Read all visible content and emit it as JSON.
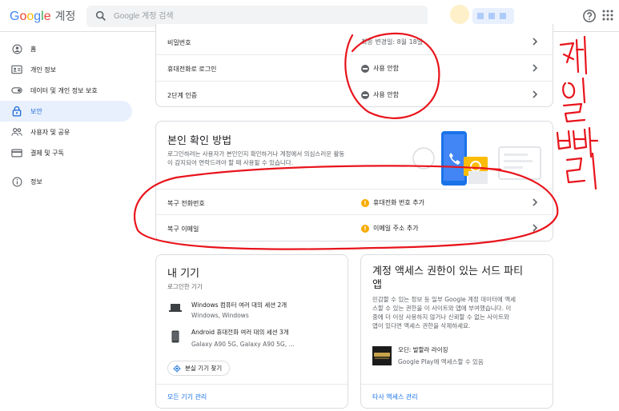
{
  "header": {
    "logo_letters": [
      "G",
      "o",
      "o",
      "g",
      "l",
      "e"
    ],
    "product": "계정",
    "search_placeholder": "Google 계정 검색"
  },
  "sidebar": {
    "items": [
      {
        "label": "홈",
        "icon": "home-icon"
      },
      {
        "label": "개인 정보",
        "icon": "id-card-icon"
      },
      {
        "label": "데이터 및 개인 정보 보호",
        "icon": "toggle-icon"
      },
      {
        "label": "보안",
        "icon": "lock-icon",
        "active": true
      },
      {
        "label": "사용자 및 공유",
        "icon": "people-icon"
      },
      {
        "label": "결제 및 구독",
        "icon": "credit-card-icon"
      },
      {
        "label": "정보",
        "icon": "info-icon"
      }
    ]
  },
  "signin": {
    "rows": [
      {
        "label": "비밀번호",
        "value": "최종 변경일: 8월 18일"
      },
      {
        "label": "휴대전화로 로그인",
        "value": "사용 안함"
      },
      {
        "label": "2단계 인증",
        "value": "사용 안함"
      }
    ]
  },
  "verify": {
    "title": "본인 확인 방법",
    "desc_line1": "로그인하려는 사용자가 본인인지 확인하거나 계정에서 의심스러운 활동",
    "desc_line2": "이 감지되어 연락드려야 할 때 사용될 수 있습니다.",
    "rows": [
      {
        "label": "복구 전화번호",
        "value": "휴대전화 번호 추가"
      },
      {
        "label": "복구 이메일",
        "value": "이메일 주소 추가"
      }
    ]
  },
  "devices": {
    "title": "내 기기",
    "subtitle": "로그인한 기기",
    "items": [
      {
        "title": "Windows 컴퓨터 여러 대의 세션 2개",
        "sub": "Windows, Windows",
        "icon": "laptop-icon"
      },
      {
        "title": "Android 휴대전화 여러 대의 세션 3개",
        "sub": "Galaxy A90 5G, Galaxy A90 5G, ...",
        "icon": "phone-icon"
      }
    ],
    "find_button": "분실 기기 찾기",
    "manage_link": "모든 기기 관리"
  },
  "thirdparty": {
    "title_line1": "계정 액세스 권한이 있는 서드 파티",
    "title_line2": "앱",
    "desc": [
      "민감할 수 있는 정보 등 일부 Google 계정 데이터에 액세",
      "스할 수 있는 권한을 이 사이트와 앱에 부여했습니다. 이",
      "중에 더 이상 사용하지 않거나 신뢰할 수 없는 사이트와",
      "앱이 있다면 액세스 권한을 삭제하세요."
    ],
    "app_name": "오딘: 발할라 라이징",
    "app_sub": "Google Play에 액세스할 수 있음",
    "manage_link": "타사 액세스 관리"
  },
  "colors": {
    "accent": "#1a73e8",
    "annotation": "#e8141c",
    "warning": "#f9ab00"
  }
}
